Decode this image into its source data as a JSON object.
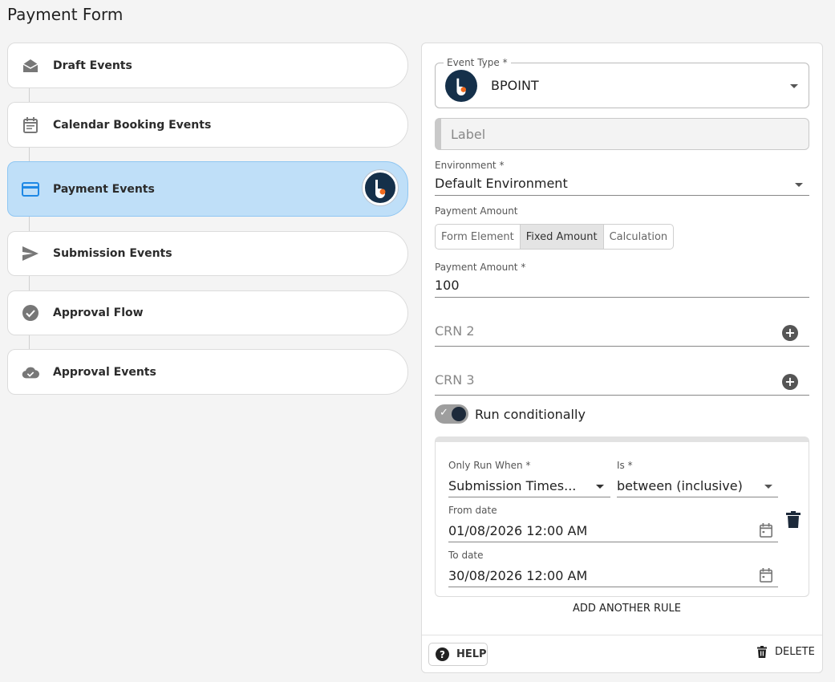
{
  "page": {
    "title": "Payment Form"
  },
  "events": [
    {
      "label": "Draft Events",
      "icon": "drafts-icon"
    },
    {
      "label": "Calendar Booking Events",
      "icon": "calendar-icon"
    },
    {
      "label": "Payment Events",
      "icon": "credit-card-icon",
      "active": true,
      "badge": "bpoint-logo"
    },
    {
      "label": "Submission Events",
      "icon": "send-icon"
    },
    {
      "label": "Approval Flow",
      "icon": "check-circle-icon"
    },
    {
      "label": "Approval Events",
      "icon": "cloud-done-icon"
    }
  ],
  "form": {
    "event_type": {
      "label": "Event Type *",
      "value": "BPOINT"
    },
    "label_field": {
      "placeholder": "Label"
    },
    "environment": {
      "label": "Environment *",
      "value": "Default Environment"
    },
    "payment_amount_mode": {
      "label": "Payment Amount",
      "options": [
        "Form Element",
        "Fixed Amount",
        "Calculation"
      ],
      "selected": "Fixed Amount"
    },
    "payment_amount": {
      "label": "Payment Amount *",
      "value": "100"
    },
    "crn2": {
      "placeholder": "CRN 2"
    },
    "crn3": {
      "placeholder": "CRN 3"
    },
    "run_conditionally": {
      "label": "Run conditionally",
      "on": true
    },
    "rule": {
      "only_run_when": {
        "label": "Only Run When *",
        "value": "Submission Times..."
      },
      "is": {
        "label": "Is *",
        "value": "between (inclusive)"
      },
      "from_date": {
        "label": "From date",
        "value": "01/08/2026 12:00 AM"
      },
      "to_date": {
        "label": "To date",
        "value": "30/08/2026 12:00 AM"
      }
    },
    "add_rule_label": "ADD ANOTHER RULE"
  },
  "footer": {
    "help_label": "HELP",
    "delete_label": "DELETE"
  },
  "colors": {
    "active_bg": "#bfdff8",
    "active_icon": "#1e88e5",
    "bpoint_navy": "#15304a",
    "bpoint_orange": "#f06a1d"
  }
}
